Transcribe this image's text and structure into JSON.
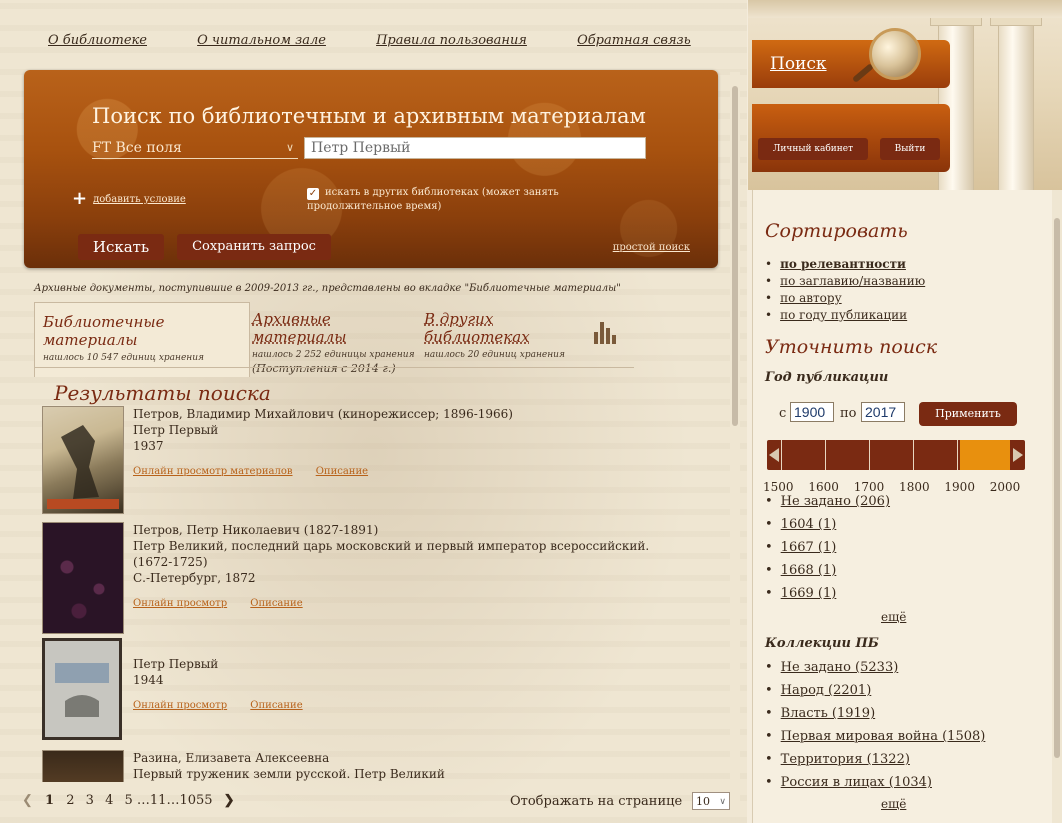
{
  "topnav": [
    "О библиотеке",
    "О читальном зале",
    "Правила пользования",
    "Обратная связь"
  ],
  "search": {
    "title": "Поиск по библиотечным и архивным материалам",
    "field": "FT Все поля",
    "query": "Петр Первый",
    "add_condition": "добавить условие",
    "search_other": "искать в других библиотеках (может занять продолжительное время)",
    "search_button": "Искать",
    "save_button": "Сохранить запрос",
    "simple_search": "простой поиск"
  },
  "archive_note": "Архивные документы, поступившие в 2009-2013 гг., представлены во вкладке \"Библиотечные материалы\"",
  "tabs": [
    {
      "label": "Библиотечные материалы",
      "sub": "нашлось 10 547 единиц хранения"
    },
    {
      "label": "Архивные материалы",
      "sub": "нашлось 2 252 единицы хранения",
      "sub2": "(Поступления с 2014 г.)"
    },
    {
      "label": "В других библиотеках",
      "sub": "нашлось 20 единиц хранения"
    }
  ],
  "results_title": "Результаты поиска",
  "results": [
    {
      "line1": "Петров, Владимир Михайлович (кинорежиссер; 1896-1966)",
      "line2": "Петр Первый",
      "line3": "1937",
      "view": "Онлайн просмотр материалов",
      "desc": "Описание"
    },
    {
      "line1": "Петров, Петр Николаевич (1827-1891)",
      "line2": "Петр Великий, последний царь московский и первый император всероссийский. (1672-1725)",
      "line3": "С.-Петербург, 1872",
      "view": "Онлайн просмотр",
      "desc": "Описание"
    },
    {
      "line1": "Петр Первый",
      "line2": "1944",
      "view": "Онлайн просмотр",
      "desc": "Описание"
    },
    {
      "line1": "Разина, Елизавета Алексеевна",
      "line2": "Первый труженик земли русской. Петр Великий"
    }
  ],
  "pager": {
    "pages": [
      "1",
      "2",
      "3",
      "4",
      "5 …11…1055"
    ],
    "per_page_label": "Отображать на странице",
    "per_page": "10"
  },
  "right": {
    "search_tab": "Поиск",
    "cabinet": "Личный кабинет",
    "logout": "Выйти",
    "sort_title": "Сортировать",
    "sort": [
      "по релевантности",
      "по заглавию/названию",
      "по автору",
      "по году публикации"
    ],
    "refine_title": "Уточнить поиск",
    "year_title": "Год публикации",
    "year_from_label": "с",
    "year_from": "1900",
    "year_to_label": "по",
    "year_to": "2017",
    "apply": "Применить",
    "scale": "1500 1600 1700 1800 1900 2000",
    "years": [
      "Не задано (206)",
      "1604 (1)",
      "1667 (1)",
      "1668 (1)",
      "1669 (1)"
    ],
    "more": "ещё",
    "collections_title": "Коллекции ПБ",
    "collections": [
      "Не задано (5233)",
      "Народ (2201)",
      "Власть (1919)",
      "Первая мировая война (1508)",
      "Территория (1322)",
      "Россия в лицах (1034)"
    ],
    "more2": "ещё"
  }
}
